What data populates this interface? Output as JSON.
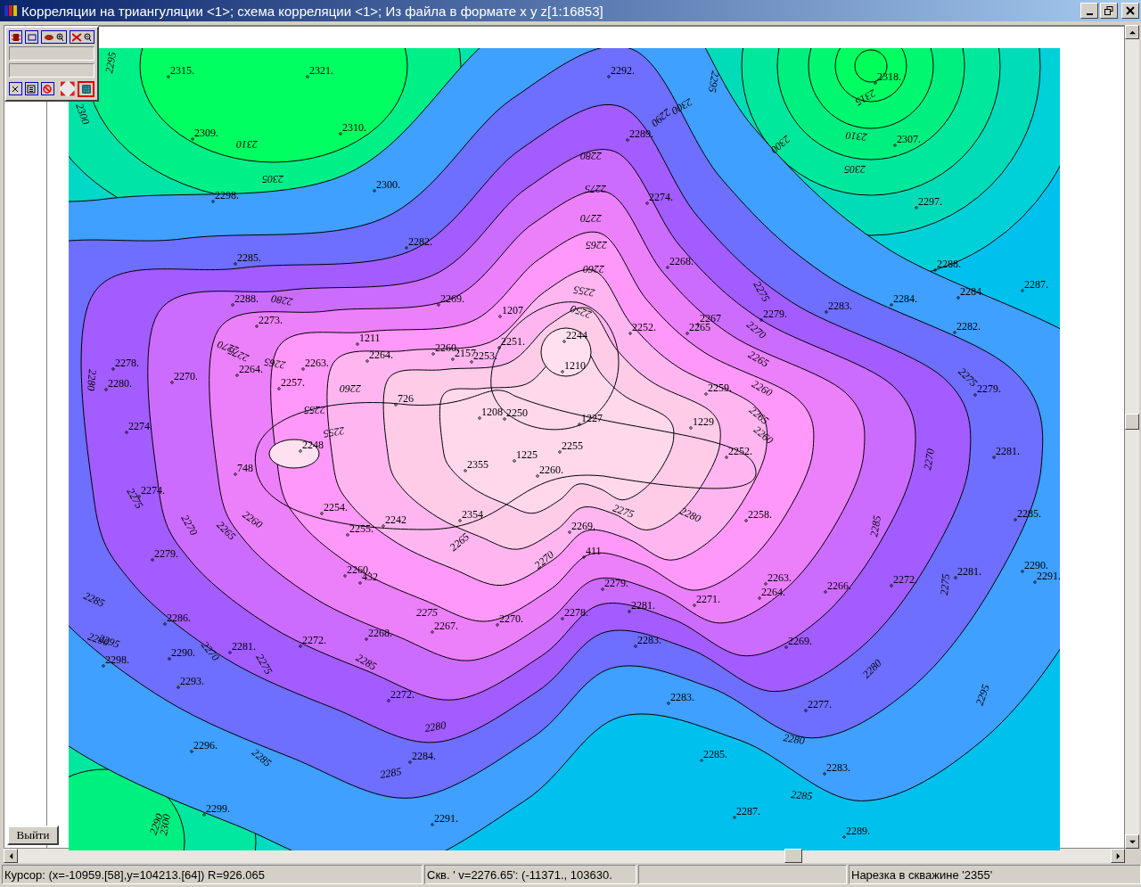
{
  "window": {
    "title": "Корреляции на триангуляции <1>; схема корреляции <1>; Из файла в формате x y z[1:16853]"
  },
  "exit_button": "Выйти",
  "wells": [
    "2315.",
    "2321.",
    "2292.",
    "2318.",
    "2309.",
    "2310.",
    "2289.",
    "2307.",
    "2298.",
    "2300.",
    "2274.",
    "2297.",
    "2282.",
    "2285.",
    "2268.",
    "2288.",
    "2288.",
    "2269.",
    "2279.",
    "2283.",
    "2284.",
    "2284.",
    "2287.",
    "1207",
    "2273.",
    "2252.",
    "2265",
    "2267",
    "2282.",
    "1211",
    "2264.",
    "2260.",
    "2157",
    "2253.",
    "2251.",
    "2244",
    "2278.",
    "2263.",
    "2264.",
    "1210",
    "2270.",
    "2280.",
    "2257.",
    "2279.",
    "2259.",
    "726",
    "1208",
    "2250",
    "1227",
    "1229",
    "2274.",
    "2248",
    "2255",
    "2252.",
    "2281.",
    "748",
    "2355",
    "1225",
    "2260.",
    "2274.",
    "2254.",
    "2242",
    "2354",
    "2258.",
    "2285.",
    "2255.",
    "2269.",
    "411",
    "2279.",
    "2260.",
    "432",
    "2290.",
    "2291.",
    "2281.",
    "2263.",
    "2272.",
    "2266.",
    "2264.",
    "2279.",
    "2271.",
    "2281.",
    "2278.",
    "2286.",
    "2270.",
    "2267.",
    "2268.",
    "2272.",
    "2281.",
    "2290.",
    "2283.",
    "2269.",
    "2298.",
    "2293.",
    "2272.",
    "2283.",
    "2277.",
    "2296.",
    "2285.",
    "2284.",
    "2283.",
    "2299.",
    "2287.",
    "2291.",
    "2289."
  ],
  "contour_labels": [
    "2310",
    "2305",
    "2280",
    "2275",
    "2270",
    "2265",
    "2260",
    "2255",
    "2250",
    "2280",
    "2300",
    "2295",
    "2305",
    "2310",
    "2315",
    "2300",
    "2290",
    "2295",
    "2300",
    "2265",
    "2270",
    "2275",
    "2260",
    "2255",
    "2275",
    "2270",
    "2265",
    "2260",
    "2265",
    "2260",
    "2270",
    "2275",
    "2280",
    "2285",
    "2290",
    "2295",
    "2275",
    "2270",
    "2265",
    "2260",
    "2255",
    "2275",
    "2280",
    "2285",
    "2275",
    "2270",
    "2265",
    "2275",
    "2280",
    "2285",
    "2290",
    "2280",
    "2285",
    "2270",
    "2275",
    "2285",
    "2295",
    "2300",
    "2280",
    "2285"
  ],
  "status_bar": {
    "cursor": "Курсор: (x=-10959.[58],y=104213.[64]) R=926.065",
    "well": "Скв. ' v=2276.65': (-11371., 103630.",
    "cut": "Нарезка в скважине '2355'"
  }
}
